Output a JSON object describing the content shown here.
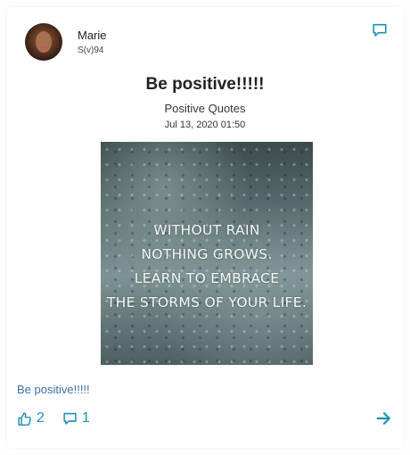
{
  "author": {
    "name": "Marie",
    "subtitle": "S(v)94"
  },
  "post": {
    "title": "Be positive!!!!!",
    "category": "Positive Quotes",
    "timestamp": "Jul 13, 2020 01:50",
    "image_quote": {
      "line1": "WITHOUT RAIN",
      "line2": "NOTHING GROWS.",
      "line3": "LEARN TO EMBRACE",
      "line4": "THE STORMS OF YOUR LIFE."
    },
    "body": "Be positive!!!!!"
  },
  "actions": {
    "likes": "2",
    "comments": "1"
  },
  "icons": {
    "comment_top": "comment-icon",
    "like": "thumbs-up-icon",
    "comment": "comment-icon",
    "next": "arrow-right-icon"
  },
  "colors": {
    "accent": "#1f8fb5",
    "body_text": "#3a6ea5"
  }
}
